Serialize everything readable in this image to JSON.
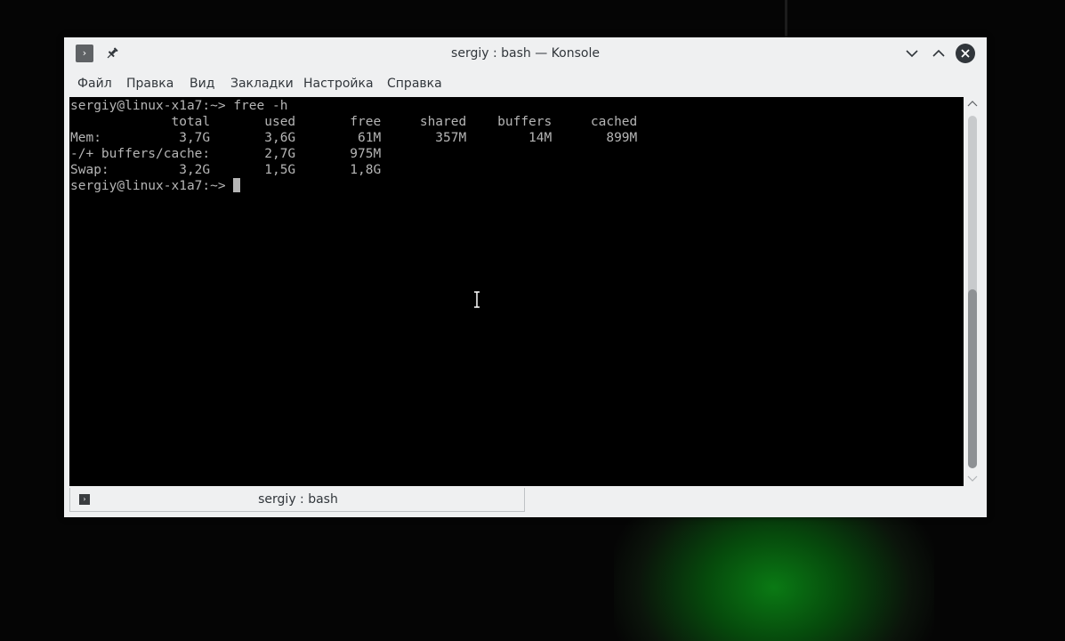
{
  "window": {
    "title": "sergiy : bash — Konsole",
    "menu_button_glyph": "›"
  },
  "menubar": {
    "items": [
      "Файл",
      "Правка",
      "Вид",
      "Закладки",
      "Настройка",
      "Справка"
    ]
  },
  "terminal": {
    "lines": [
      "sergiy@linux-x1a7:~> free -h",
      "             total       used       free     shared    buffers     cached",
      "Mem:          3,7G       3,6G        61M       357M        14M       899M",
      "-/+ buffers/cache:       2,7G       975M",
      "Swap:         3,2G       1,5G       1,8G"
    ],
    "prompt": "sergiy@linux-x1a7:~> ",
    "text_color": "#b5b5b5",
    "background": "#000000"
  },
  "scrollbar": {
    "position_fraction": 0.49
  },
  "tabs": [
    {
      "label": "sergiy : bash",
      "icon": "terminal-icon"
    }
  ],
  "colors": {
    "chrome": "#eff0f1",
    "text": "#31363b",
    "close_button": "#31363b"
  }
}
